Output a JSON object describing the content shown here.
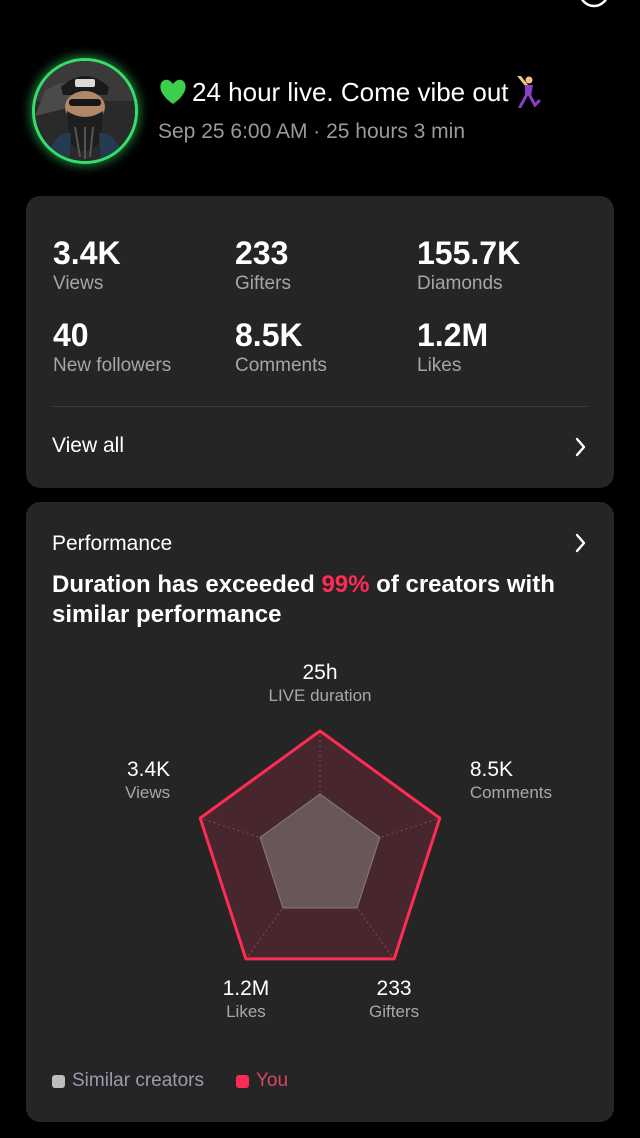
{
  "header": {
    "title": "24 hour live. Come vibe out",
    "subtitle": "Sep 25 6:00 AM · 25 hours 3 min"
  },
  "stats": [
    {
      "value": "3.4K",
      "label": "Views"
    },
    {
      "value": "233",
      "label": "Gifters"
    },
    {
      "value": "155.7K",
      "label": "Diamonds"
    },
    {
      "value": "40",
      "label": "New followers"
    },
    {
      "value": "8.5K",
      "label": "Comments"
    },
    {
      "value": "1.2M",
      "label": "Likes"
    }
  ],
  "view_all_label": "View all",
  "performance": {
    "heading": "Performance",
    "summary_prefix": "Duration has exceeded ",
    "summary_pct": "99%",
    "summary_suffix": " of creators with similar performance"
  },
  "chart_data": {
    "type": "radar",
    "axes": [
      {
        "name": "LIVE duration",
        "value_label": "25h"
      },
      {
        "name": "Comments",
        "value_label": "8.5K"
      },
      {
        "name": "Gifters",
        "value_label": "233"
      },
      {
        "name": "Likes",
        "value_label": "1.2M"
      },
      {
        "name": "Views",
        "value_label": "3.4K"
      }
    ],
    "series": [
      {
        "name": "Similar creators",
        "color": "#6f6060",
        "values": [
          0.5,
          0.5,
          0.5,
          0.5,
          0.5
        ]
      },
      {
        "name": "You",
        "color": "#fe2c55",
        "values": [
          1.0,
          1.0,
          1.0,
          1.0,
          1.0
        ]
      }
    ],
    "legend_position": "bottom-left",
    "legend": [
      {
        "label": "Similar creators",
        "color": "#bdbdbd"
      },
      {
        "label": "You",
        "color": "#fe2c55"
      }
    ]
  },
  "colors": {
    "accent": "#fe2c55",
    "live_ring": "#35e06a",
    "card_bg": "#252525"
  }
}
